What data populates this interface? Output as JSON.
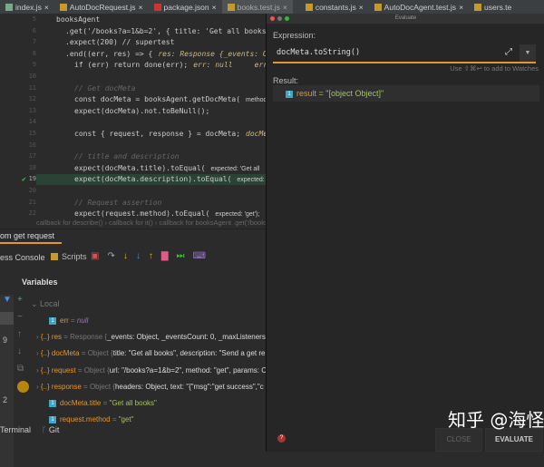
{
  "tabs": [
    "index.js",
    "AutoDocRequest.js",
    "package.json",
    "books.test.js",
    "constants.js",
    "AutoDocAgent.test.js",
    "users.te"
  ],
  "code": {
    "lines": [
      {
        "n": "5",
        "t": "booksAgent"
      },
      {
        "n": "6",
        "t": ".get('/books?a=1&b=2', { title: 'Get all books', d"
      },
      {
        "n": "7",
        "t": ".expect(200) // supertest"
      },
      {
        "n": "8",
        "t": ".end((err, res) => {",
        "h": "res: Response {_events: Obj"
      },
      {
        "n": "9",
        "t": "if (err) return done(err);",
        "h": "err: null     err: n"
      },
      {
        "n": "10",
        "t": ""
      },
      {
        "n": "11",
        "t": "// Get docMeta"
      },
      {
        "n": "12",
        "t": "const docMeta = booksAgent.getDocMeta(",
        "h": "method: 'ge"
      },
      {
        "n": "13",
        "t": "expect(docMeta).not.toBeNull();"
      },
      {
        "n": "14",
        "t": ""
      },
      {
        "n": "15",
        "t": "const { request, response } = docMeta;",
        "h": "docMeta"
      },
      {
        "n": "16",
        "t": ""
      },
      {
        "n": "17",
        "t": "// title and description"
      },
      {
        "n": "18",
        "t": "expect(docMeta.title).toEqual(",
        "h": "expected: 'Get all"
      },
      {
        "n": "19",
        "t": "expect(docMeta.description).toEqual(",
        "h": "expected: 'Se"
      },
      {
        "n": "20",
        "t": ""
      },
      {
        "n": "21",
        "t": "// Request assertion"
      },
      {
        "n": "22",
        "t": "expect(request.method).toEqual(",
        "h": "expected: 'get');"
      }
    ],
    "breadcrumb": [
      "callback for describe()",
      "callback for it()",
      "callback for booksAgent .get('/books"
    ]
  },
  "debug": {
    "session_tab": "om get request",
    "console_tab": "ess Console",
    "scripts_tab": "Scripts",
    "variables_title": "Variables",
    "local": "Local",
    "vars": [
      {
        "name": "err",
        "eq": " = ",
        "val": "null",
        "kind": "prim"
      },
      {
        "name": "res",
        "eq": " = Response {",
        "val": "_events: Object, _eventsCount: 0, _maxListeners:",
        "kind": "obj"
      },
      {
        "name": "docMeta",
        "eq": " = Object {",
        "val": "title: \"Get all books\", description: \"Send a get re",
        "kind": "obj"
      },
      {
        "name": "request",
        "eq": " = Object {",
        "val": "url: \"/books?a=1&b=2\", method: \"get\", params: C",
        "kind": "obj"
      },
      {
        "name": "response",
        "eq": " = Object {",
        "val": "headers: Object, text: \"{\"msg\":\"get success\",\"c",
        "kind": "obj"
      },
      {
        "name": "docMeta.title",
        "eq": " = ",
        "val": "\"Get all books\"",
        "kind": "prim"
      },
      {
        "name": "request.method",
        "eq": " = ",
        "val": "\"get\"",
        "kind": "prim"
      }
    ],
    "side_nums": [
      "9",
      "2"
    ],
    "terminal": "Terminal",
    "git": "Git"
  },
  "evaluate": {
    "title": "Evaluate",
    "expression_label": "Expression:",
    "expression": "docMeta.toString()",
    "hint": "Use ⇧⌘↩ to add to Watches",
    "result_label": "Result:",
    "result_name": "result",
    "result_value": " = \"[object Object]\"",
    "close": "CLOSE",
    "evaluate": "EVALUATE"
  },
  "watermark": "知乎 @海怪"
}
